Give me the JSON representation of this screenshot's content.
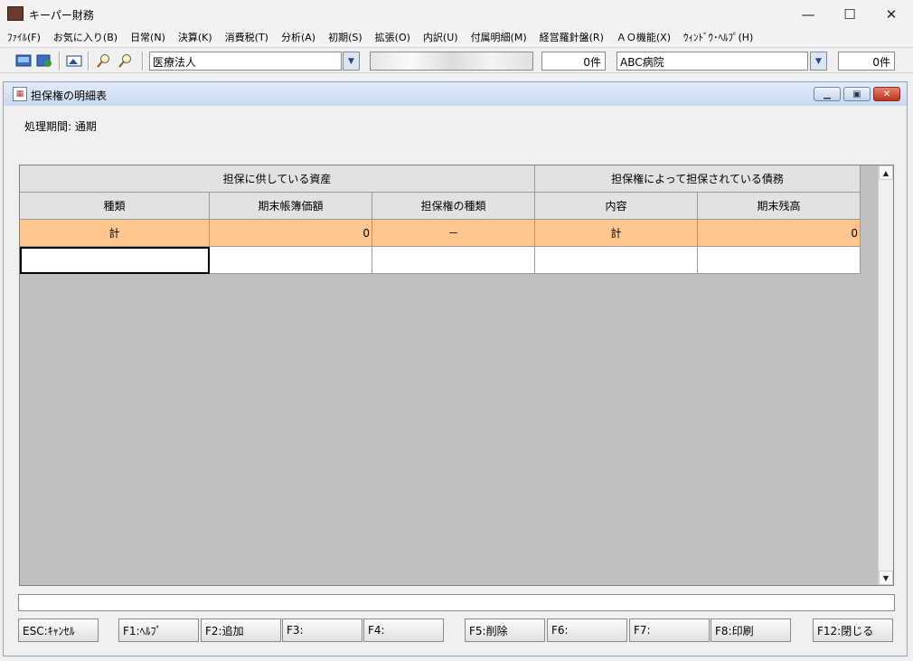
{
  "app": {
    "title": "キーパー財務",
    "controls": {
      "minimize": "—",
      "maximize": "☐",
      "close": "✕"
    }
  },
  "menu": [
    "ﾌｧｲﾙ(F)",
    "お気に入り(B)",
    "日常(N)",
    "決算(K)",
    "消費税(T)",
    "分析(A)",
    "初期(S)",
    "拡張(O)",
    "内訳(U)",
    "付属明細(M)",
    "経営羅針盤(R)",
    "ＡＯ機能(X)",
    "ｳｨﾝﾄﾞｳ･ﾍﾙﾌﾟ(H)"
  ],
  "toolbar": {
    "icons": [
      "open-icon",
      "refresh-icon",
      "image-icon",
      "zoom-in-icon",
      "zoom-out-icon"
    ],
    "company_type": "医療法人",
    "count1": "0件",
    "company_name": "ABC病院",
    "count2": "0件"
  },
  "window": {
    "title": "担保権の明細表",
    "period_label": "処理期間: 通期"
  },
  "grid": {
    "group_headers": {
      "assets": "担保に供している資産",
      "debts": "担保権によって担保されている債務"
    },
    "columns": [
      "種類",
      "期末帳簿価額",
      "担保権の種類",
      "内容",
      "期末残高"
    ],
    "total_row": [
      "計",
      "0",
      "－",
      "計",
      "0"
    ],
    "scroll_up": "▲",
    "scroll_down": "▼"
  },
  "function_keys": [
    "ESC:ｷｬﾝｾﾙ",
    "F1:ﾍﾙﾌﾟ",
    "F2:追加",
    "F3:",
    "F4:",
    "F5:削除",
    "F6:",
    "F7:",
    "F8:印刷",
    "F12:閉じる"
  ],
  "colors": {
    "total_row": "#ffc690",
    "header": "#e2e2e2",
    "grid_bg": "#c0c0c0"
  }
}
